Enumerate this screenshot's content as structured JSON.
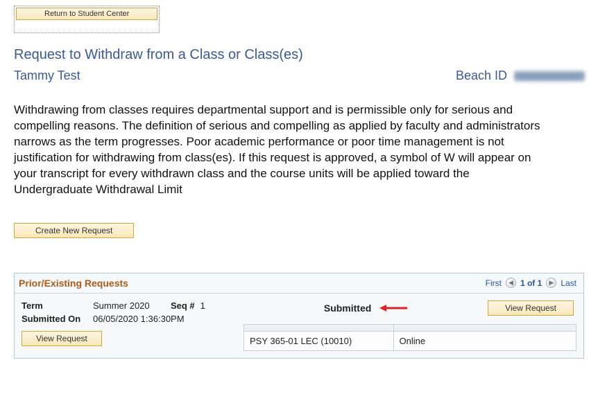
{
  "top_button": "Return to Student Center",
  "page_title": "Request to Withdraw from a Class or Class(es)",
  "student_name": "Tammy Test",
  "beach_id_label": "Beach ID",
  "body_text": "Withdrawing from classes requires departmental support and is permissible only for serious and compelling reasons. The definition of serious and compelling as applied by faculty and administrators narrows as the term progresses. Poor academic performance or poor time management is not justification for withdrawing from class(es). If this request is approved, a symbol of W will appear on your transcript for every withdrawn class and the course units will be applied toward the Undergraduate Withdrawal Limit",
  "create_button": "Create New Request",
  "prior": {
    "title": "Prior/Existing Requests",
    "pager": {
      "first": "First",
      "range": "1 of 1",
      "last": "Last"
    },
    "term_label": "Term",
    "term_value": "Summer 2020",
    "seq_label": "Seq #",
    "seq_value": "1",
    "submitted_on_label": "Submitted On",
    "submitted_on_value": "06/05/2020  1:36:30PM",
    "view_button": "View Request",
    "status": "Submitted",
    "class": {
      "course": "PSY 365-01 LEC (10010)",
      "mode": "Online"
    }
  }
}
